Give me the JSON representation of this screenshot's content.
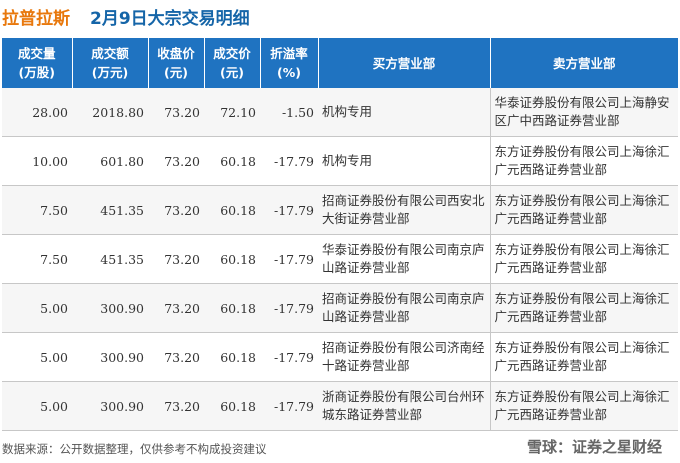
{
  "title": {
    "company": "拉普拉斯",
    "subject": "2月9日大宗交易明细"
  },
  "columns": [
    {
      "line1": "成交量",
      "line2": "(万股)"
    },
    {
      "line1": "成交额",
      "line2": "(万元)"
    },
    {
      "line1": "收盘价",
      "line2": "(元)"
    },
    {
      "line1": "成交价",
      "line2": "(元)"
    },
    {
      "line1": "折溢率",
      "line2": "(%)"
    },
    {
      "line1": "买方营业部",
      "line2": ""
    },
    {
      "line1": "卖方营业部",
      "line2": ""
    }
  ],
  "rows": [
    {
      "volume": "28.00",
      "amount": "2018.80",
      "close": "73.20",
      "price": "72.10",
      "premium": "-1.50",
      "buyer": "机构专用",
      "seller": "华泰证券股份有限公司上海静安区广中西路证券营业部"
    },
    {
      "volume": "10.00",
      "amount": "601.80",
      "close": "73.20",
      "price": "60.18",
      "premium": "-17.79",
      "buyer": "机构专用",
      "seller": "东方证券股份有限公司上海徐汇广元西路证券营业部"
    },
    {
      "volume": "7.50",
      "amount": "451.35",
      "close": "73.20",
      "price": "60.18",
      "premium": "-17.79",
      "buyer": "招商证券股份有限公司西安北大街证券营业部",
      "seller": "东方证券股份有限公司上海徐汇广元西路证券营业部"
    },
    {
      "volume": "7.50",
      "amount": "451.35",
      "close": "73.20",
      "price": "60.18",
      "premium": "-17.79",
      "buyer": "华泰证券股份有限公司南京庐山路证券营业部",
      "seller": "东方证券股份有限公司上海徐汇广元西路证券营业部"
    },
    {
      "volume": "5.00",
      "amount": "300.90",
      "close": "73.20",
      "price": "60.18",
      "premium": "-17.79",
      "buyer": "招商证券股份有限公司南京庐山路证券营业部",
      "seller": "东方证券股份有限公司上海徐汇广元西路证券营业部"
    },
    {
      "volume": "5.00",
      "amount": "300.90",
      "close": "73.20",
      "price": "60.18",
      "premium": "-17.79",
      "buyer": "招商证券股份有限公司济南经十路证券营业部",
      "seller": "东方证券股份有限公司上海徐汇广元西路证券营业部"
    },
    {
      "volume": "5.00",
      "amount": "300.90",
      "close": "73.20",
      "price": "60.18",
      "premium": "-17.79",
      "buyer": "浙商证券股份有限公司台州环城东路证券营业部",
      "seller": "东方证券股份有限公司上海徐汇广元西路证券营业部"
    }
  ],
  "footer": {
    "source": "数据来源：公开数据整理，仅供参考不构成投资建议",
    "brand": "雪球：证券之星财经"
  },
  "watermark": "证券之星",
  "colors": {
    "header": "#1f73c1",
    "company": "#e8780c",
    "subject": "#1565a8",
    "negative": "#1a9a3a"
  }
}
